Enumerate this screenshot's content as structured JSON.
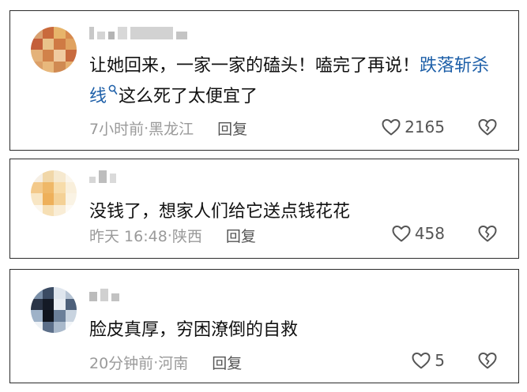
{
  "comments": [
    {
      "text_parts": [
        "让她回来，一家一家的磕头！嗑完了再说！",
        "跌落斩杀线",
        "这么死了太便宜了"
      ],
      "link_icon": "search-icon",
      "time": "7小时前",
      "location": "黑龙江",
      "reply_label": "回复",
      "likes": "2165"
    },
    {
      "text": "没钱了，想家人们给它送点钱花花",
      "time": "昨天 16:48",
      "location": "陕西",
      "reply_label": "回复",
      "likes": "458"
    },
    {
      "text": "脸皮真厚，穷困潦倒的自救",
      "time": "20分钟前",
      "location": "河南",
      "reply_label": "回复",
      "likes": "5"
    }
  ],
  "meta_separator": "·",
  "icons": {
    "like": "heart-outline-icon",
    "dislike": "broken-heart-icon"
  },
  "colors": {
    "text": "#111111",
    "link": "#1d5fa8",
    "meta": "#9a9a9a",
    "border": "#2b2b2b"
  }
}
